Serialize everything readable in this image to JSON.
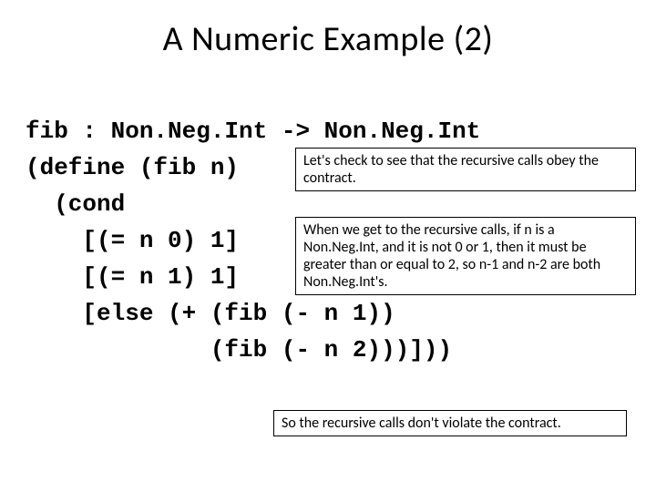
{
  "title": "A Numeric Example (2)",
  "code": {
    "l1": "fib : Non.Neg.Int -> Non.Neg.Int",
    "l2": "(define (fib n)",
    "l3": "  (cond",
    "l4": "    [(= n 0) 1]",
    "l5": "    [(= n 1) 1]",
    "l6": "    [else (+ (fib (- n 1))",
    "l7": "             (fib (- n 2)))]))"
  },
  "notes": {
    "n1": "Let's check to see that the recursive calls obey the contract.",
    "n2": "When we get to the recursive calls, if n is a Non.Neg.Int, and it is not 0 or 1, then it must be greater than or equal to 2, so n-1 and n-2 are both Non.Neg.Int's.",
    "n3": "So the recursive calls don't violate the contract."
  }
}
